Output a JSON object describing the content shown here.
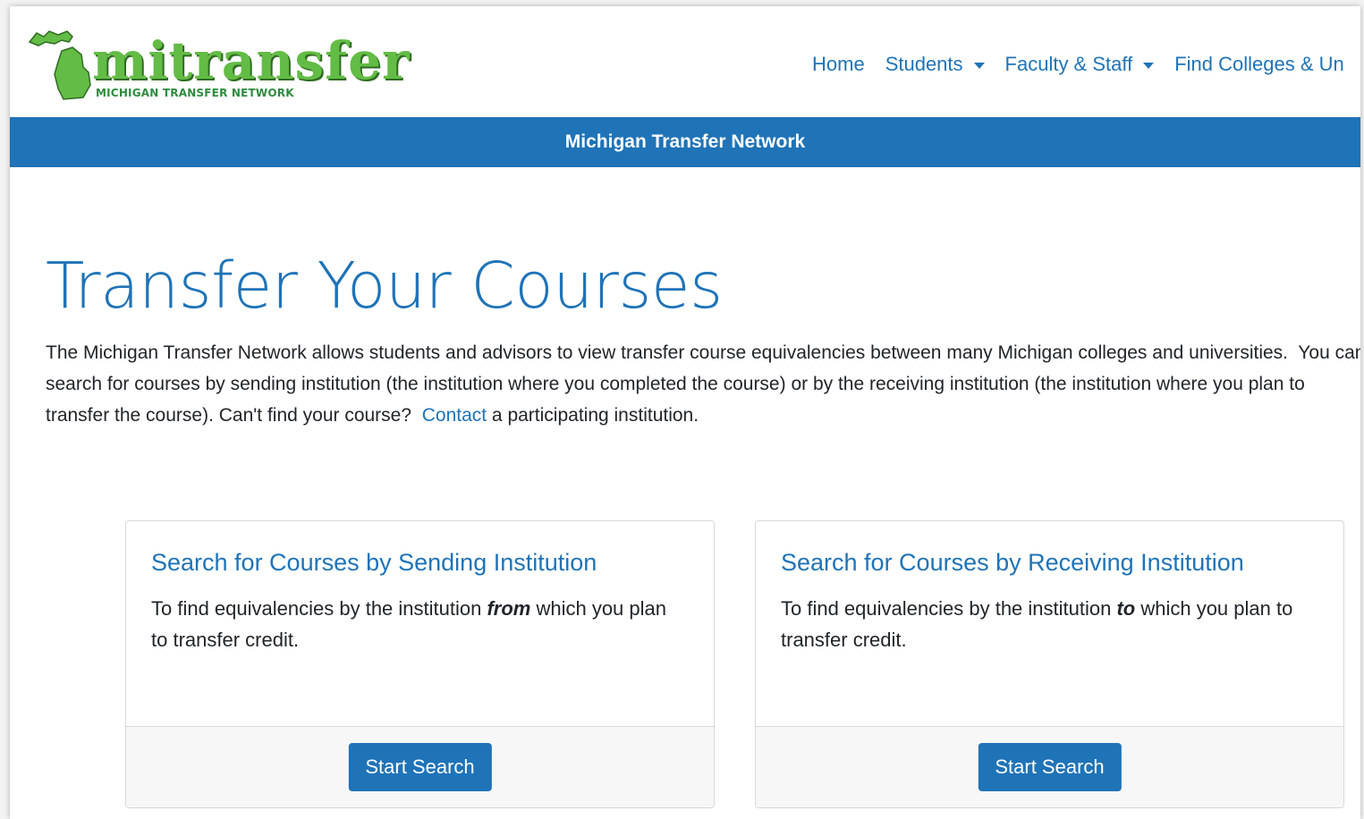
{
  "header": {
    "logo": {
      "wordmark": "mitransfer",
      "subtitle": "MICHIGAN TRANSFER NETWORK"
    },
    "nav": [
      {
        "label": "Home",
        "dropdown": false
      },
      {
        "label": "Students",
        "dropdown": true
      },
      {
        "label": "Faculty & Staff",
        "dropdown": true
      },
      {
        "label": "Find Colleges & Un",
        "dropdown": false
      }
    ]
  },
  "banner": {
    "text": "Michigan Transfer Network"
  },
  "main": {
    "title": "Transfer Your Courses",
    "intro_before_link": "The Michigan Transfer Network allows students and advisors to view transfer course equivalencies between many Michigan colleges and universities.  You can search for courses by sending institution (the institution where you completed the course) or by the receiving institution (the institution where you plan to transfer the course). Can't find your course?  ",
    "intro_link": "Contact",
    "intro_after_link": " a participating institution."
  },
  "cards": [
    {
      "title": "Search for Courses by Sending Institution",
      "text_before": "To find equivalencies by the institution ",
      "text_emphasis": "from",
      "text_after": " which you plan to transfer credit.",
      "button": "Start Search"
    },
    {
      "title": "Search for Courses by Receiving Institution",
      "text_before": "To find equivalencies by the institution ",
      "text_emphasis": "to",
      "text_after": " which you plan to transfer credit.",
      "button": "Start Search"
    }
  ],
  "colors": {
    "brand_blue": "#1f73b7",
    "logo_green": "#63bc45",
    "text": "#212529"
  },
  "icons": [
    "michigan-map-icon",
    "caret-down-icon"
  ]
}
